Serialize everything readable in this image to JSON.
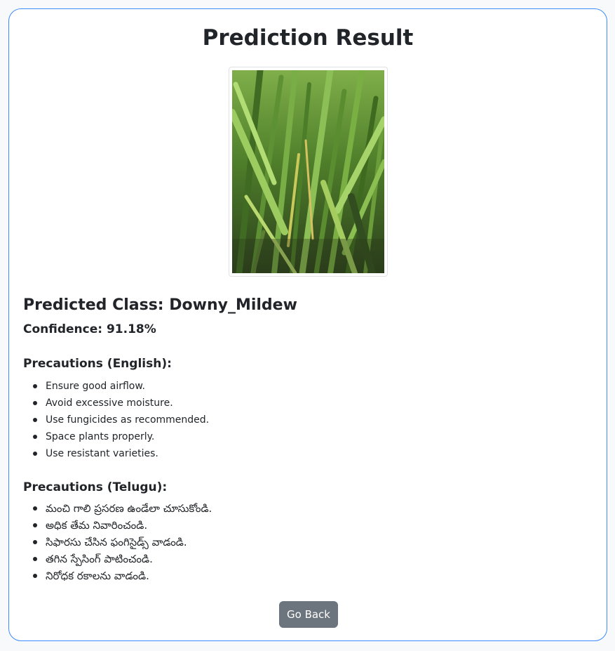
{
  "page": {
    "title": "Prediction Result"
  },
  "image": {
    "alt": "Uploaded crop leaf image",
    "subject": "green-crop-leaves-photo"
  },
  "result": {
    "predicted_class": "Predicted Class: Downy_Mildew",
    "confidence": "Confidence: 91.18%"
  },
  "precautions_english": {
    "heading": "Precautions (English):",
    "items": [
      "Ensure good airflow.",
      "Avoid excessive moisture.",
      "Use fungicides as recommended.",
      "Space plants properly.",
      "Use resistant varieties."
    ]
  },
  "precautions_telugu": {
    "heading": "Precautions (Telugu):",
    "items": [
      "మంచి గాలి ప్రసరణ ఉండేలా చూసుకోండి.",
      "అధిక తేమ నివారించండి.",
      "సిఫారసు చేసిన ఫంగిసైడ్స్ వాడండి.",
      "తగిన స్పేసింగ్ పాటించండి.",
      "నిరోధక రకాలను వాడండి."
    ]
  },
  "actions": {
    "back_label": "Go Back"
  },
  "colors": {
    "card_border": "#3d8bfd",
    "button_bg": "#6c757d",
    "button_text": "#ffffff",
    "text": "#212529"
  }
}
